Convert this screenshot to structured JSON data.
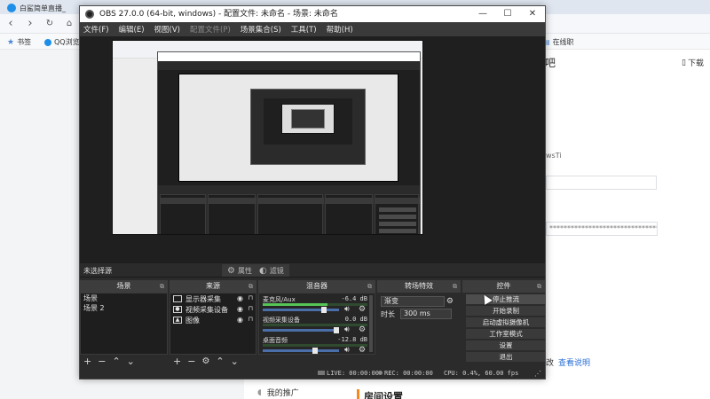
{
  "browser": {
    "tab_title": "白鲨简单直播_",
    "bookmarks": [
      {
        "label": "书签",
        "icon": "star-icon"
      },
      {
        "label": "QQ浏览"
      }
    ],
    "right_bookmark": "在线职",
    "page": {
      "header_fragment": "吧",
      "download_label": "下载",
      "token_short": "wsTi",
      "token_long": "************************************&wsTin",
      "help_text": "查看说明",
      "help_prefix": "改",
      "sidebar_item": "我的推广",
      "section_title": "房间设置"
    }
  },
  "obs": {
    "title": "OBS 27.0.0 (64-bit, windows) - 配置文件: 未命名 - 场景: 未命名",
    "menu": [
      {
        "label": "文件(F)",
        "disabled": false
      },
      {
        "label": "编辑(E)",
        "disabled": false
      },
      {
        "label": "视图(V)",
        "disabled": false
      },
      {
        "label": "配置文件(P)",
        "disabled": true
      },
      {
        "label": "场景集合(S)",
        "disabled": false
      },
      {
        "label": "工具(T)",
        "disabled": false
      },
      {
        "label": "帮助(H)",
        "disabled": false
      }
    ],
    "toolbar": {
      "no_source": "未选择源",
      "properties": "属性",
      "filters": "滤镜"
    },
    "scenes": {
      "title": "场景",
      "items": [
        "场景",
        "场景 2"
      ]
    },
    "sources": {
      "title": "来源",
      "items": [
        {
          "label": "显示器采集",
          "icon": "monitor-icon"
        },
        {
          "label": "视频采集设备",
          "icon": "camera-icon"
        },
        {
          "label": "图像",
          "icon": "image-icon"
        }
      ]
    },
    "mixer": {
      "title": "混音器",
      "channels": [
        {
          "name": "麦克风/Aux",
          "db": "-6.4 dB",
          "level": 0.62,
          "volume": 0.82
        },
        {
          "name": "视频采集设备",
          "db": "0.0 dB",
          "level": 0.0,
          "volume": 1.0
        },
        {
          "name": "桌面音频",
          "db": "-12.8 dB",
          "level": 0.0,
          "volume": 0.7
        }
      ]
    },
    "transitions": {
      "title": "转场特效",
      "type": "渐变",
      "duration_label": "时长",
      "duration_value": "300 ms"
    },
    "controls": {
      "title": "控件",
      "buttons": [
        {
          "label": "停止推流",
          "active": true
        },
        {
          "label": "开始录制",
          "active": false
        },
        {
          "label": "启动虚拟摄像机",
          "active": false
        },
        {
          "label": "工作室模式",
          "active": false
        },
        {
          "label": "设置",
          "active": false
        },
        {
          "label": "退出",
          "active": false
        }
      ]
    },
    "status": {
      "live": "LIVE: 00:00:00",
      "rec": "REC: 00:00:00",
      "cpu": "CPU: 0.4%, 60.00 fps"
    }
  },
  "colors": {
    "accent": "#f28b1b",
    "link": "#2b6fd6",
    "meter_green": "#55c555",
    "slider_blue": "#4a6ea8"
  }
}
